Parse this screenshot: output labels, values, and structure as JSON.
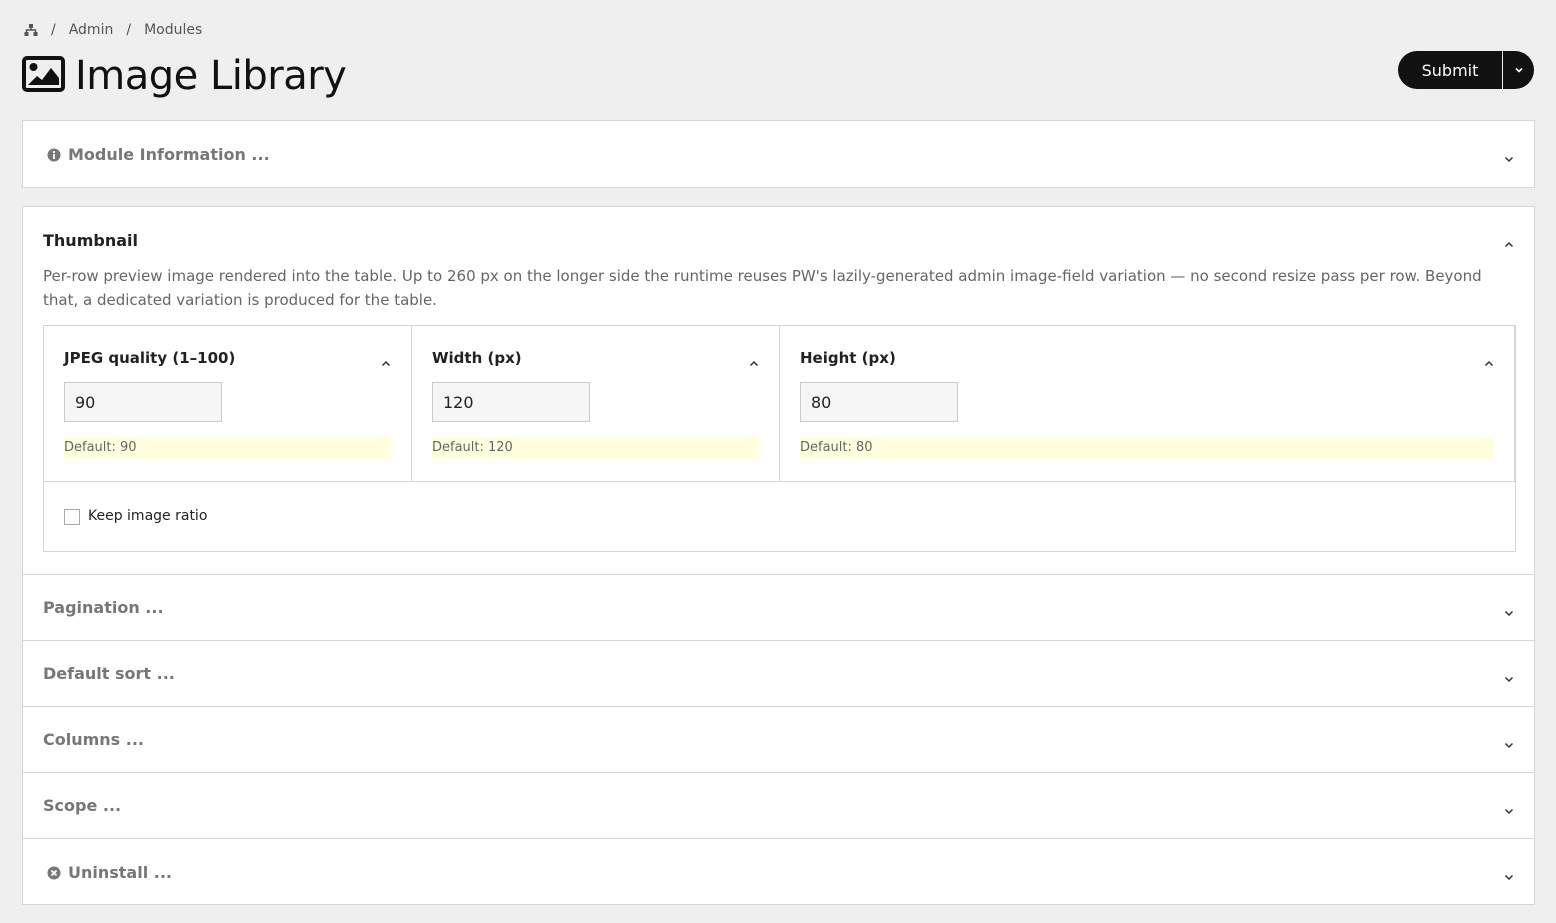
{
  "breadcrumb": {
    "home_icon": "sitemap-icon",
    "items": [
      "Admin",
      "Modules"
    ],
    "separator": "/"
  },
  "page": {
    "title": "Image Library",
    "title_icon": "image-icon"
  },
  "actions": {
    "submit_label": "Submit",
    "caret_icon": "chevron-down-icon"
  },
  "panels": {
    "module_info": {
      "label": "Module Information ...",
      "icon": "info-circle-icon",
      "collapsed": true
    },
    "thumbnail": {
      "label": "Thumbnail",
      "collapsed": false,
      "description": "Per-row preview image rendered into the table. Up to 260 px on the longer side the runtime reuses PW's lazily-generated admin image-field variation — no second resize pass per row. Beyond that, a dedicated variation is produced for the table.",
      "fields": [
        {
          "label": "JPEG quality (1–100)",
          "value": "90",
          "note": "Default: 90"
        },
        {
          "label": "Width (px)",
          "value": "120",
          "note": "Default: 120"
        },
        {
          "label": "Height (px)",
          "value": "80",
          "note": "Default: 80"
        }
      ],
      "keep_ratio": {
        "label": "Keep image ratio",
        "checked": false
      }
    },
    "pagination": {
      "label": "Pagination ...",
      "collapsed": true
    },
    "default_sort": {
      "label": "Default sort ...",
      "collapsed": true
    },
    "columns": {
      "label": "Columns ...",
      "collapsed": true
    },
    "scope": {
      "label": "Scope ...",
      "collapsed": true
    },
    "uninstall": {
      "label": "Uninstall ...",
      "icon": "times-circle-icon",
      "collapsed": true
    }
  },
  "colors": {
    "background": "#efefef",
    "button": "#111111",
    "note_background": "#ffffdd",
    "border": "#d6d6d6"
  }
}
